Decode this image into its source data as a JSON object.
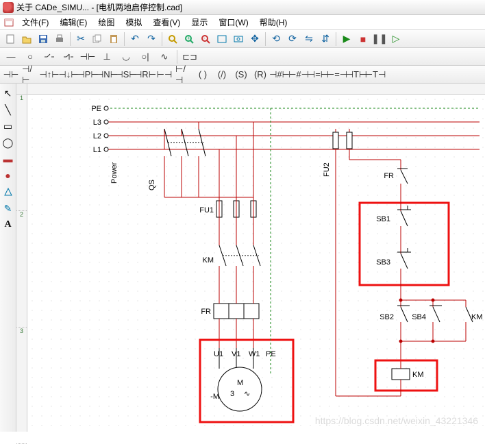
{
  "window": {
    "title": "关于 CADe_SIMU... - [电机两地启停控制.cad]"
  },
  "menu": {
    "items": [
      "文件(F)",
      "编辑(E)",
      "绘图",
      "模拟",
      "查看(V)",
      "显示",
      "窗口(W)",
      "帮助(H)"
    ]
  },
  "ruler": {
    "v": [
      "1",
      "2",
      "3"
    ]
  },
  "schematic": {
    "labels": {
      "PE": "PE",
      "L3": "L3",
      "L2": "L2",
      "L1": "L1",
      "Power": "Power",
      "QS": "QS",
      "FU1": "FU1",
      "FU2": "FU2",
      "KM": "KM",
      "FR": "FR",
      "U1": "U1",
      "V1": "V1",
      "W1": "W1",
      "PE2": "PE",
      "M": "M",
      "M3": "3",
      "minusM": "-M",
      "SB1": "SB1",
      "SB3": "SB3",
      "SB2": "SB2",
      "SB4": "SB4",
      "KM2": "KM",
      "KM3": "KM",
      "FR2": "FR"
    }
  },
  "watermark": "https://blog.csdn.net/weixin_43221346"
}
